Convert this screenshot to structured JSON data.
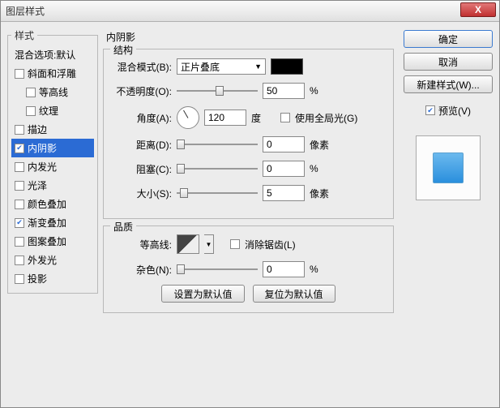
{
  "window": {
    "title": "图层样式"
  },
  "buttons": {
    "ok": "确定",
    "cancel": "取消",
    "newStyle": "新建样式(W)...",
    "close": "X",
    "setDefault": "设置为默认值",
    "resetDefault": "复位为默认值"
  },
  "preview": {
    "label": "预览(V)"
  },
  "leftPanel": {
    "heading": "样式",
    "blend": "混合选项:默认",
    "items": [
      {
        "label": "斜面和浮雕",
        "checked": false,
        "indent": false
      },
      {
        "label": "等高线",
        "checked": false,
        "indent": true
      },
      {
        "label": "纹理",
        "checked": false,
        "indent": true
      },
      {
        "label": "描边",
        "checked": false,
        "indent": false
      },
      {
        "label": "内阴影",
        "checked": true,
        "indent": false,
        "selected": true
      },
      {
        "label": "内发光",
        "checked": false,
        "indent": false
      },
      {
        "label": "光泽",
        "checked": false,
        "indent": false
      },
      {
        "label": "颜色叠加",
        "checked": false,
        "indent": false
      },
      {
        "label": "渐变叠加",
        "checked": true,
        "indent": false
      },
      {
        "label": "图案叠加",
        "checked": false,
        "indent": false
      },
      {
        "label": "外发光",
        "checked": false,
        "indent": false
      },
      {
        "label": "投影",
        "checked": false,
        "indent": false
      }
    ]
  },
  "center": {
    "title": "内阴影",
    "structure": {
      "legend": "结构",
      "blendMode": {
        "label": "混合模式(B):",
        "value": "正片叠底"
      },
      "opacity": {
        "label": "不透明度(O):",
        "value": "50",
        "unit": "%"
      },
      "angle": {
        "label": "角度(A):",
        "value": "120",
        "unit": "度",
        "globalLabel": "使用全局光(G)",
        "globalChecked": false
      },
      "distance": {
        "label": "距离(D):",
        "value": "0",
        "unit": "像素"
      },
      "choke": {
        "label": "阻塞(C):",
        "value": "0",
        "unit": "%"
      },
      "size": {
        "label": "大小(S):",
        "value": "5",
        "unit": "像素"
      }
    },
    "quality": {
      "legend": "品质",
      "contour": {
        "label": "等高线:",
        "antiAlias": "消除锯齿(L)",
        "antiAliasChecked": false
      },
      "noise": {
        "label": "杂色(N):",
        "value": "0",
        "unit": "%"
      }
    }
  }
}
